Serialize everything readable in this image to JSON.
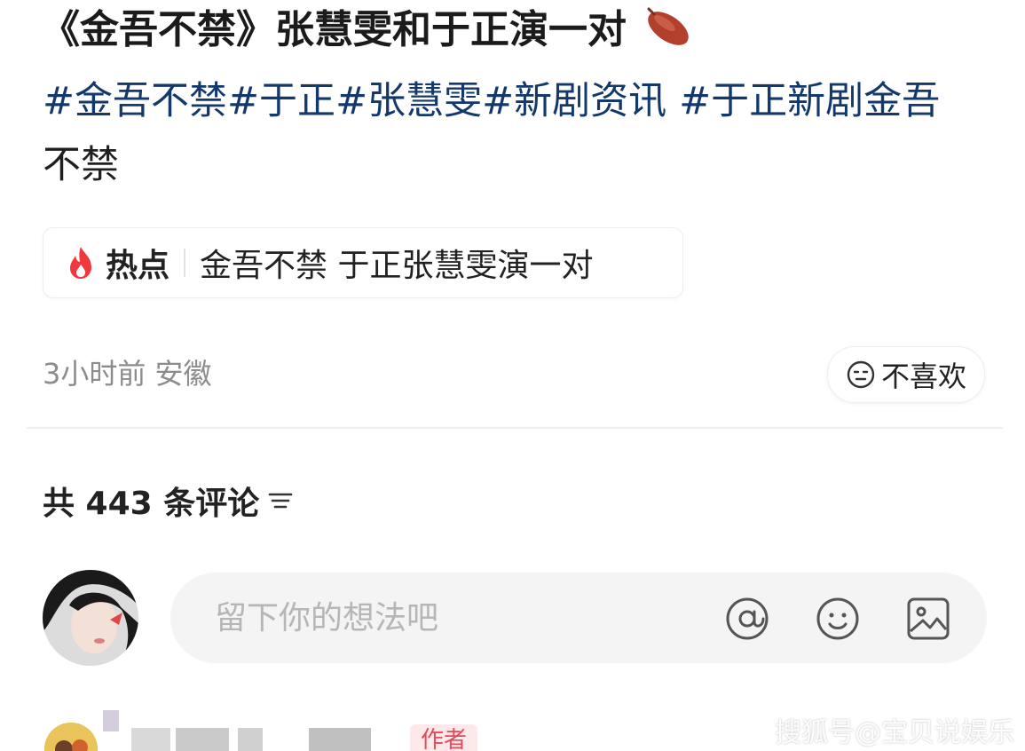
{
  "post": {
    "title": "《金吾不禁》张慧雯和于正演一对",
    "title_icon": "sweet-potato-icon",
    "tags": [
      "#金吾不禁",
      "#于正",
      "#张慧雯",
      "#新剧资讯",
      "#于正新剧金吾",
      "不禁"
    ],
    "hot": {
      "label": "热点",
      "text": "金吾不禁 于正张慧雯演一对",
      "icon": "fire-icon",
      "icon_color": "#f0383f"
    },
    "meta": "3小时前 安徽",
    "dislike_label": "不喜欢"
  },
  "comments": {
    "count_text": "共 443 条评论",
    "input_placeholder": "留下你的想法吧",
    "input_icons": [
      "at-icon",
      "emoji-icon",
      "image-icon"
    ],
    "first_comment_badge": "作者"
  },
  "watermark": "搜狐号@宝贝说娱乐",
  "colors": {
    "tag": "#13386b",
    "meta": "#8c8c8c",
    "placeholder": "#b6b6b6",
    "author_badge": "#e24b5a"
  }
}
